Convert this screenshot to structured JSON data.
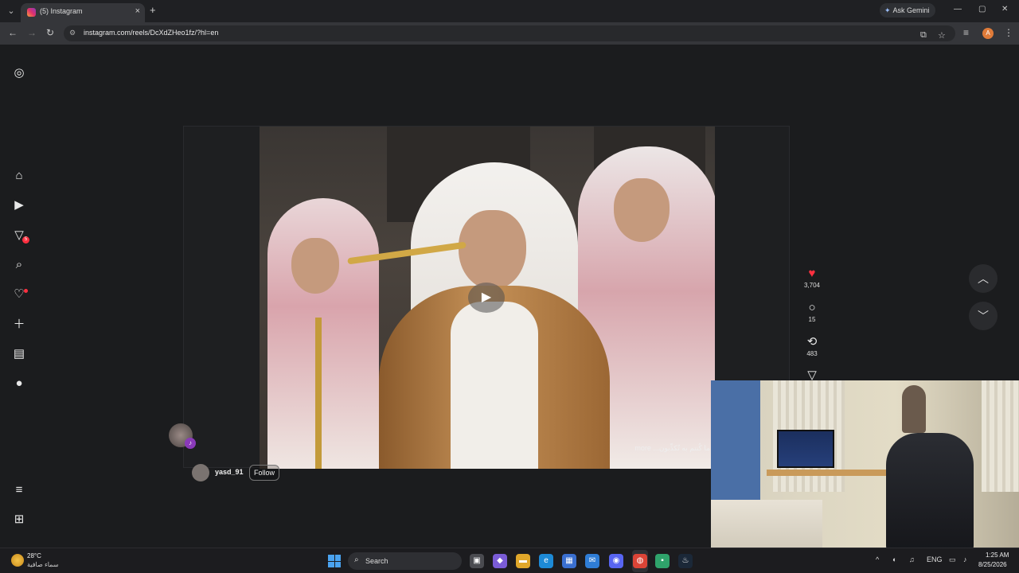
{
  "browser": {
    "tab_title": "(5) Instagram",
    "new_tab": "+",
    "close_tab": "×",
    "ask_gemini": "Ask Gemini",
    "url": "instagram.com/reels/DcXdZHeo1fz/?hl=en",
    "profile_initial": "A",
    "window_controls": {
      "minimize": "—",
      "maximize": "▢",
      "close": "✕"
    }
  },
  "sidebar": {
    "notifications_badge": "5"
  },
  "reel": {
    "username": "yasd_91",
    "follow_label": "Follow",
    "caption": "more ...ما كُنتم به تُكذِّبون",
    "likes": "3,704",
    "comments": "15",
    "reposts": "483"
  },
  "taskbar": {
    "temperature": "28°C",
    "weather_desc": "سماء صافية",
    "search_label": "Search",
    "language": "ENG",
    "time": "1:25 AM",
    "date": "8/25/2026"
  },
  "colors": {
    "background": "#1b1c1e",
    "heart": "#ff3040",
    "badge": "#ff3040"
  }
}
